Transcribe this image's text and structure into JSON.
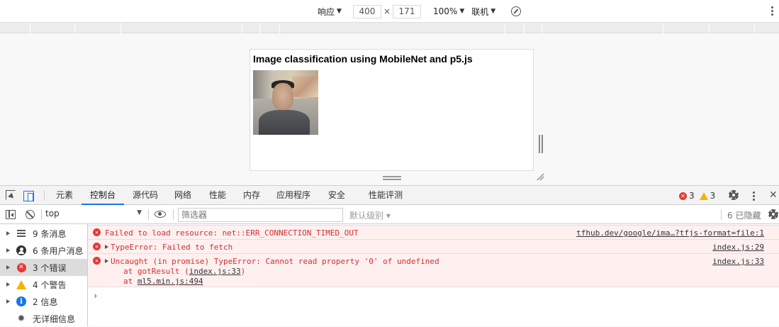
{
  "device_toolbar": {
    "device_mode": "响应",
    "width": "400",
    "times": "×",
    "height": "171",
    "zoom": "100%",
    "network": "联机"
  },
  "emulated_page": {
    "title": "Image classification using MobileNet and p5.js"
  },
  "devtools": {
    "tabs": [
      "元素",
      "控制台",
      "源代码",
      "网络",
      "性能",
      "内存",
      "应用程序",
      "安全",
      "性能评测"
    ],
    "active_tab": "控制台",
    "error_count": "3",
    "warning_count": "3",
    "close": "✕",
    "filter": {
      "context": "top",
      "placeholder": "筛选器",
      "levels": "默认级别 ▾",
      "hidden": "6 已隐藏"
    },
    "sidebar": [
      {
        "label": "9 条消息",
        "icon": "list-icon"
      },
      {
        "label": "6 条用户消息",
        "icon": "user-icon"
      },
      {
        "label": "3 个错误",
        "icon": "error-icon"
      },
      {
        "label": "4 个警告",
        "icon": "warning-icon"
      },
      {
        "label": "2 信息",
        "icon": "info-icon"
      },
      {
        "label": "无详细信息",
        "icon": "bug-icon"
      }
    ],
    "messages": [
      {
        "text": "Failed to load resource: net::ERR_CONNECTION_TIMED_OUT",
        "source": "tfhub.dev/google/ima…?tfjs-format=file:1"
      },
      {
        "text": "TypeError: Failed to fetch",
        "source": "index.js:29"
      },
      {
        "text": "Uncaught (in promise) TypeError: Cannot read property '0' of undefined",
        "source": "index.js:33",
        "stack": [
          {
            "prefix": "at gotResult (",
            "link": "index.js:33",
            "suffix": ")"
          },
          {
            "prefix": "at ",
            "link": "ml5.min.js:494",
            "suffix": ""
          }
        ]
      }
    ],
    "prompt": "›"
  },
  "colors": {
    "accent": "#1a73e8",
    "error": "#d32f2f",
    "error_bg": "#fff0f0",
    "warning": "#f4b400"
  }
}
